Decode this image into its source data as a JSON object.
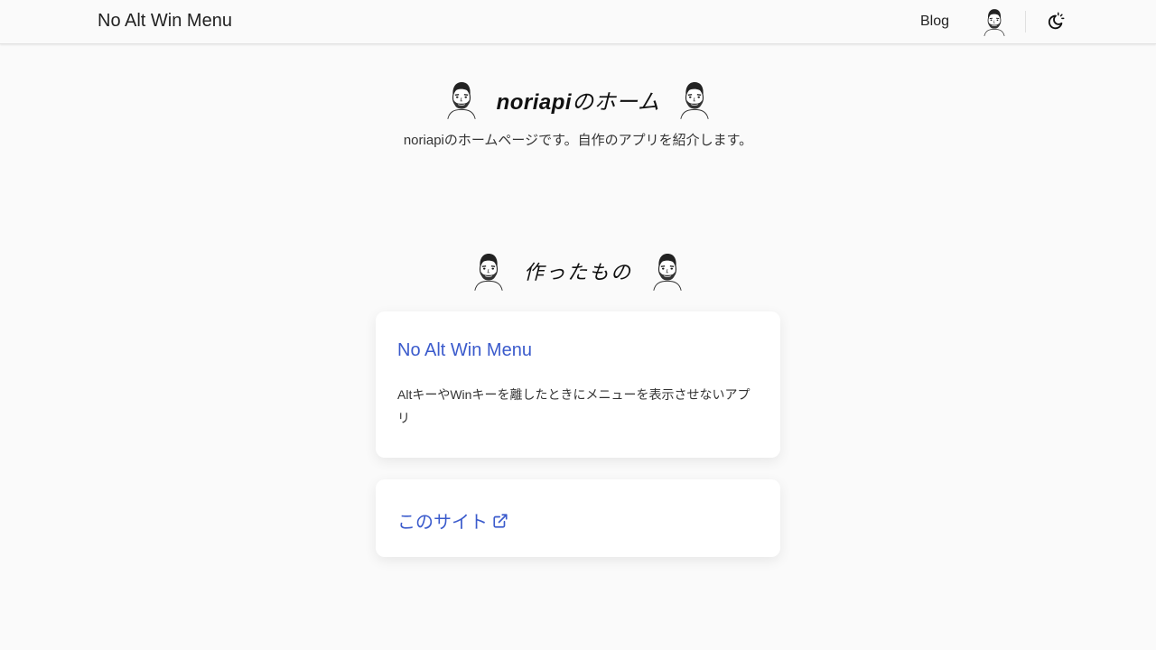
{
  "navbar": {
    "site_title": "No Alt Win Menu",
    "blog_link": "Blog",
    "avatar_icon": "avatar-face-icon",
    "theme_icon": "theme-toggle-icon"
  },
  "hero": {
    "title_en": "noriapi",
    "title_ja": "のホーム",
    "subtitle": "noriapiのホームページです。自作のアプリを紹介します。"
  },
  "section": {
    "title": "作ったもの"
  },
  "cards": [
    {
      "title": "No Alt Win Menu",
      "description": "AltキーやWinキーを離したときにメニューを表示させないアプリ"
    },
    {
      "title": "このサイト",
      "icon": "external-link-icon"
    }
  ],
  "colors": {
    "link": "#3b5bcc",
    "background": "#fafafa",
    "card": "#ffffff"
  }
}
